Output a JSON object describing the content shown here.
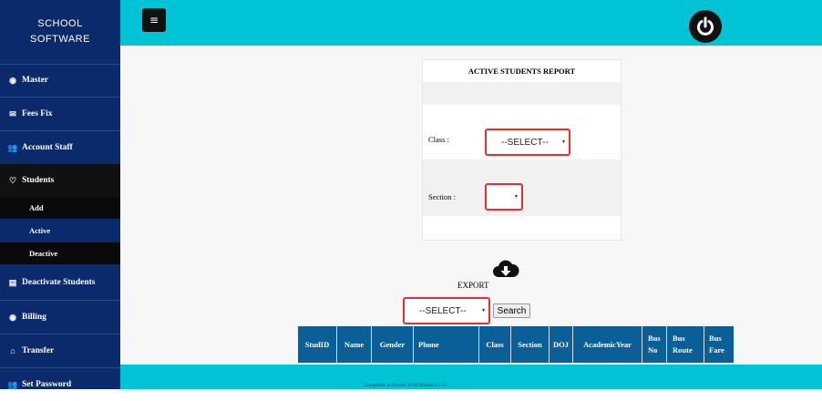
{
  "app": {
    "title_line1": "SCHOOL",
    "title_line2": "SOFTWARE"
  },
  "sidebar": {
    "items": [
      {
        "label": "Master",
        "icon": "dashboard-icon"
      },
      {
        "label": "Fees Fix",
        "icon": "envelope-icon"
      },
      {
        "label": "Account Staff",
        "icon": "users-icon"
      },
      {
        "label": "Students",
        "icon": "heart-icon"
      },
      {
        "label": "Deactivate Students",
        "icon": "id-card-icon"
      },
      {
        "label": "Billing",
        "icon": "dashboard-icon"
      },
      {
        "label": "Transfer",
        "icon": "home-icon"
      },
      {
        "label": "Set Password",
        "icon": "users-icon"
      }
    ],
    "students_submenu": [
      "Add",
      "Active",
      "Deactive"
    ]
  },
  "topbar": {
    "menu_icon": "hamburger-icon",
    "power_icon": "power-icon"
  },
  "report": {
    "title": "ACTIVE STUDENTS REPORT",
    "class_label": "Class :",
    "class_value": "--SELECT--",
    "section_label": "Section :",
    "section_value": ""
  },
  "export": {
    "label": "EXPORT",
    "icon": "cloud-download-icon",
    "select_value": "--SELECT--",
    "search_label": "Search"
  },
  "table": {
    "columns": [
      "StudID",
      "Name",
      "Gender",
      "Phone",
      "Class",
      "Section",
      "DOJ",
      "AcademicYear",
      "Bus No",
      "Bus Route",
      "Bus Fare"
    ]
  },
  "footer": {
    "text": "Compatible in Chrome 15-19 Mozilla 3.1-3.1"
  },
  "colors": {
    "sidebar": "#0b2a6b",
    "topbar": "#00c4d6",
    "table_header": "#0a5f96",
    "select_border": "#e53030"
  }
}
